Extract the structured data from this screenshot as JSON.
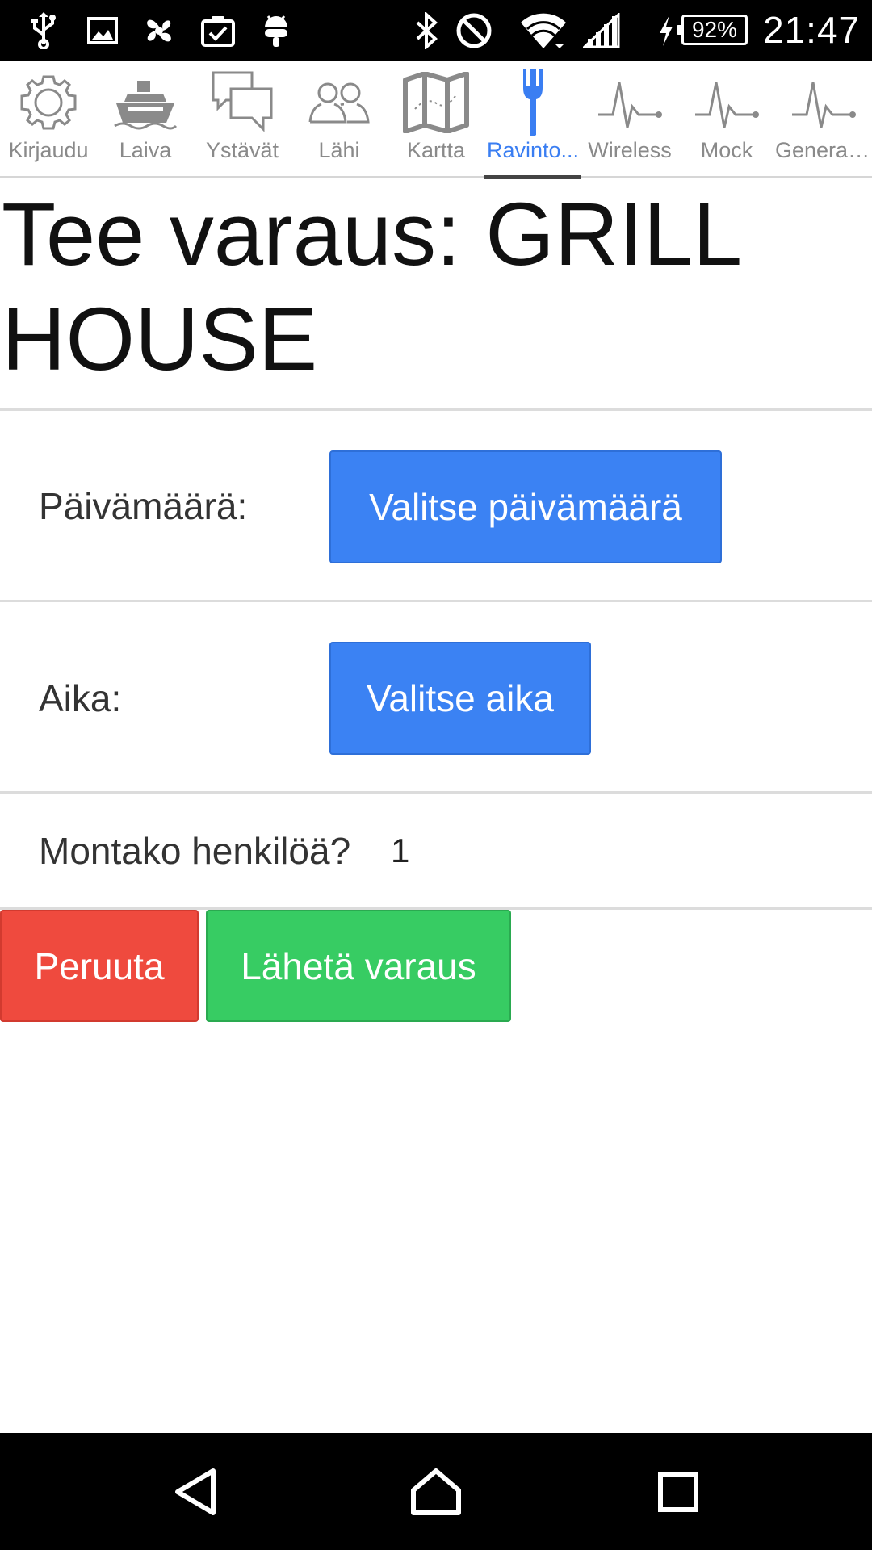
{
  "status_bar": {
    "battery_percent": "92%",
    "time": "21:47",
    "icons": [
      "usb-icon",
      "image-icon",
      "pinwheel-icon",
      "clipboard-check-icon",
      "android-icon",
      "bluetooth-icon",
      "do-not-disturb-icon",
      "wifi-icon",
      "signal-icon",
      "charging-icon",
      "battery-icon"
    ]
  },
  "tabs": [
    {
      "label": "Kirjaudu",
      "icon": "gear-icon",
      "active": false
    },
    {
      "label": "Laiva",
      "icon": "ship-icon",
      "active": false
    },
    {
      "label": "Ystävät",
      "icon": "chat-bubbles-icon",
      "active": false
    },
    {
      "label": "Lähi",
      "icon": "people-icon",
      "active": false
    },
    {
      "label": "Kartta",
      "icon": "map-icon",
      "active": false
    },
    {
      "label": "Ravinto...",
      "icon": "fork-icon",
      "active": true
    },
    {
      "label": "Wireless",
      "icon": "pulse-icon",
      "active": false
    },
    {
      "label": "Mock",
      "icon": "pulse-icon",
      "active": false
    },
    {
      "label": "Generat...",
      "icon": "pulse-icon",
      "active": false
    }
  ],
  "page": {
    "title": "Tee varaus: GRILL HOUSE"
  },
  "form": {
    "date_label": "Päivämäärä:",
    "date_button": "Valitse päivämäärä",
    "time_label": "Aika:",
    "time_button": "Valitse aika",
    "people_label": "Montako henkilöä?",
    "people_value": "1"
  },
  "actions": {
    "cancel": "Peruuta",
    "submit": "Lähetä varaus"
  },
  "colors": {
    "accent_blue": "#3b82f3",
    "cancel_red": "#ef4a3e",
    "submit_green": "#37cc63",
    "active_tab": "#3a7ef2"
  },
  "nav_bar": [
    "back-icon",
    "home-icon",
    "recents-icon"
  ]
}
